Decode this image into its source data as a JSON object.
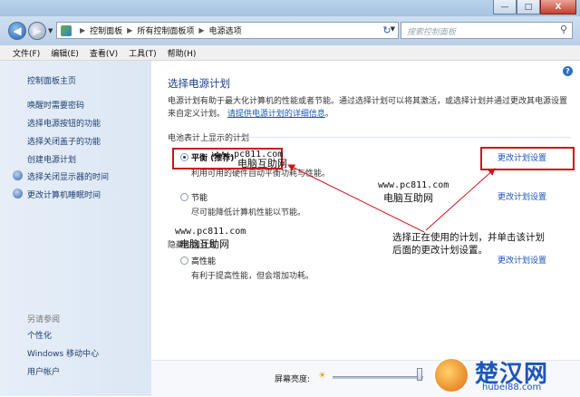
{
  "window": {
    "caption_buttons": {
      "minimize": "—",
      "maximize": "□",
      "close": "X"
    }
  },
  "address_bar": {
    "breadcrumbs": [
      "控制面板",
      "所有控制面板项",
      "电源选项"
    ],
    "search_placeholder": "搜索控制面板"
  },
  "menu": {
    "items": [
      "文件(F)",
      "编辑(E)",
      "查看(V)",
      "工具(T)",
      "帮助(H)"
    ]
  },
  "sidebar": {
    "home": "控制面板主页",
    "links": [
      "唤醒时需要密码",
      "选择电源按钮的功能",
      "选择关闭盖子的功能",
      "创建电源计划",
      "选择关闭显示器的时间",
      "更改计算机睡眠时间"
    ],
    "see_also_title": "另请参阅",
    "see_also": [
      "个性化",
      "Windows 移动中心",
      "用户帐户"
    ]
  },
  "main": {
    "title": "选择电源计划",
    "description": "电源计划有助于最大化计算机的性能或者节能。通过选择计划可以将其激活，或选择计划并通过更改其电源设置来自定义计划。",
    "description_link": "请提供电源计划的详细信息",
    "group_title": "电池表计上显示的计划",
    "hidden_plans_title": "隐藏附加计划",
    "plans": [
      {
        "name": "平衡 (推荐)",
        "desc": "利用可用的硬件自动平衡功耗与性能。",
        "link": "更改计划设置",
        "checked": true
      },
      {
        "name": "节能",
        "desc": "尽可能降低计算机性能以节能。",
        "link": "更改计划设置",
        "checked": false
      },
      {
        "name": "高性能",
        "desc": "有利于提高性能，但会增加功耗。",
        "link": "更改计划设置",
        "checked": false
      }
    ],
    "brightness_label": "屏幕亮度:",
    "brightness_level": 0.96
  },
  "annotation": {
    "line1": "选择正在使用的计划，并单击该计划",
    "line2": "后面的更改计划设置。"
  },
  "watermarks": {
    "url": "www.pc811.com",
    "name": "电脑互助网"
  },
  "logo": {
    "text": "楚汉网",
    "url": "hubei88.com"
  },
  "colors": {
    "highlight_red": "#d0131a",
    "link_blue": "#1a56b8",
    "title_blue": "#1b3f8a"
  }
}
